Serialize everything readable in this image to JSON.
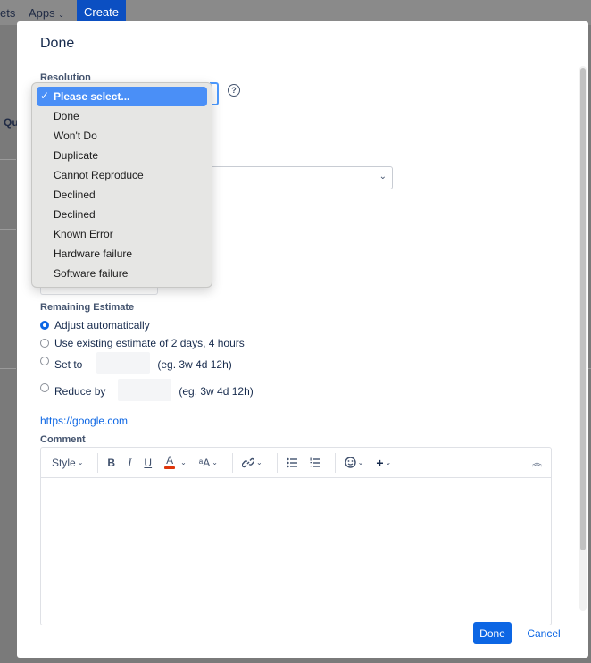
{
  "nav": {
    "item_fragment": "ets",
    "apps_label": "Apps",
    "create_label": "Create"
  },
  "background": {
    "fragment": "Qu"
  },
  "dialog": {
    "title": "Done",
    "resolution": {
      "label": "Resolution",
      "help_icon": "question-circle-icon",
      "options": [
        {
          "label": "Please select...",
          "selected": true
        },
        {
          "label": "Done",
          "selected": false
        },
        {
          "label": "Won't Do",
          "selected": false
        },
        {
          "label": "Duplicate",
          "selected": false
        },
        {
          "label": "Cannot Reproduce",
          "selected": false
        },
        {
          "label": "Declined",
          "selected": false
        },
        {
          "label": "Declined",
          "selected": false
        },
        {
          "label": "Known Error",
          "selected": false
        },
        {
          "label": "Hardware failure",
          "selected": false
        },
        {
          "label": "Software failure",
          "selected": false
        }
      ]
    },
    "remaining_estimate": {
      "label": "Remaining Estimate",
      "adjust_label": "Adjust automatically",
      "existing_label": "Use existing estimate of 2 days, 4 hours",
      "set_to_label": "Set to",
      "set_to_hint": "(eg. 3w 4d 12h)",
      "reduce_by_label": "Reduce by",
      "reduce_by_hint": "(eg. 3w 4d 12h)",
      "selected": "adjust"
    },
    "link": "https://google.com",
    "comment": {
      "label": "Comment",
      "toolbar": {
        "style_label": "Style",
        "bold": "B",
        "italic": "I",
        "underline": "U",
        "text_color": "A",
        "text_color_value": "#de350b",
        "more_formatting": "ᵃA",
        "icons": [
          "link-icon",
          "bullet-list-icon",
          "numbered-list-icon",
          "emoji-icon",
          "insert-plus-icon",
          "collapse-toolbar-icon"
        ]
      }
    },
    "buttons": {
      "done": "Done",
      "cancel": "Cancel"
    }
  },
  "colors": {
    "primary": "#0c66e4",
    "dropdown_highlight": "#4a8ff7",
    "create": "#0b4fc2"
  }
}
